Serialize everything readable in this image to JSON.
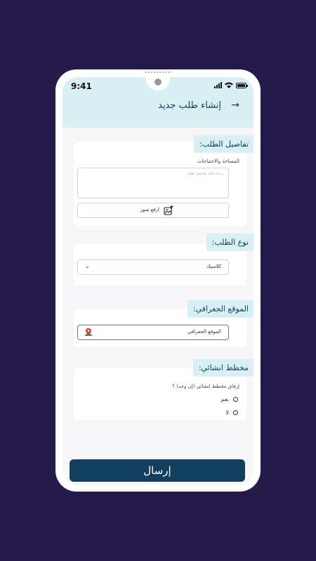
{
  "status_bar": {
    "time": "9:41"
  },
  "header": {
    "title": "إنشاء طلب جديد",
    "back_icon": "arrow-right-icon"
  },
  "details_section": {
    "tag": "تفاصيل الطلب:",
    "field_label": "المساحة والاحتياجات",
    "textarea_placeholder": "برجاء كتابة تفاصيل طلبك",
    "upload_label": "ارفع صور"
  },
  "type_section": {
    "tag": "نوع الطلب:",
    "selected_value": "كلاسيك"
  },
  "location_section": {
    "tag": "الموقع الجغرافي:",
    "field_value": "الموقع الجغرافي"
  },
  "plan_section": {
    "tag": "مخطط انشائي:",
    "question": "إرفاق مخطط انشائي (إن وجد) ؟",
    "options": [
      "نعم",
      "لا"
    ]
  },
  "submit_label": "إرسال",
  "colors": {
    "background": "#241b4b",
    "header": "#d8eff4",
    "primary": "#123f5e",
    "pin": "#e0382c"
  }
}
